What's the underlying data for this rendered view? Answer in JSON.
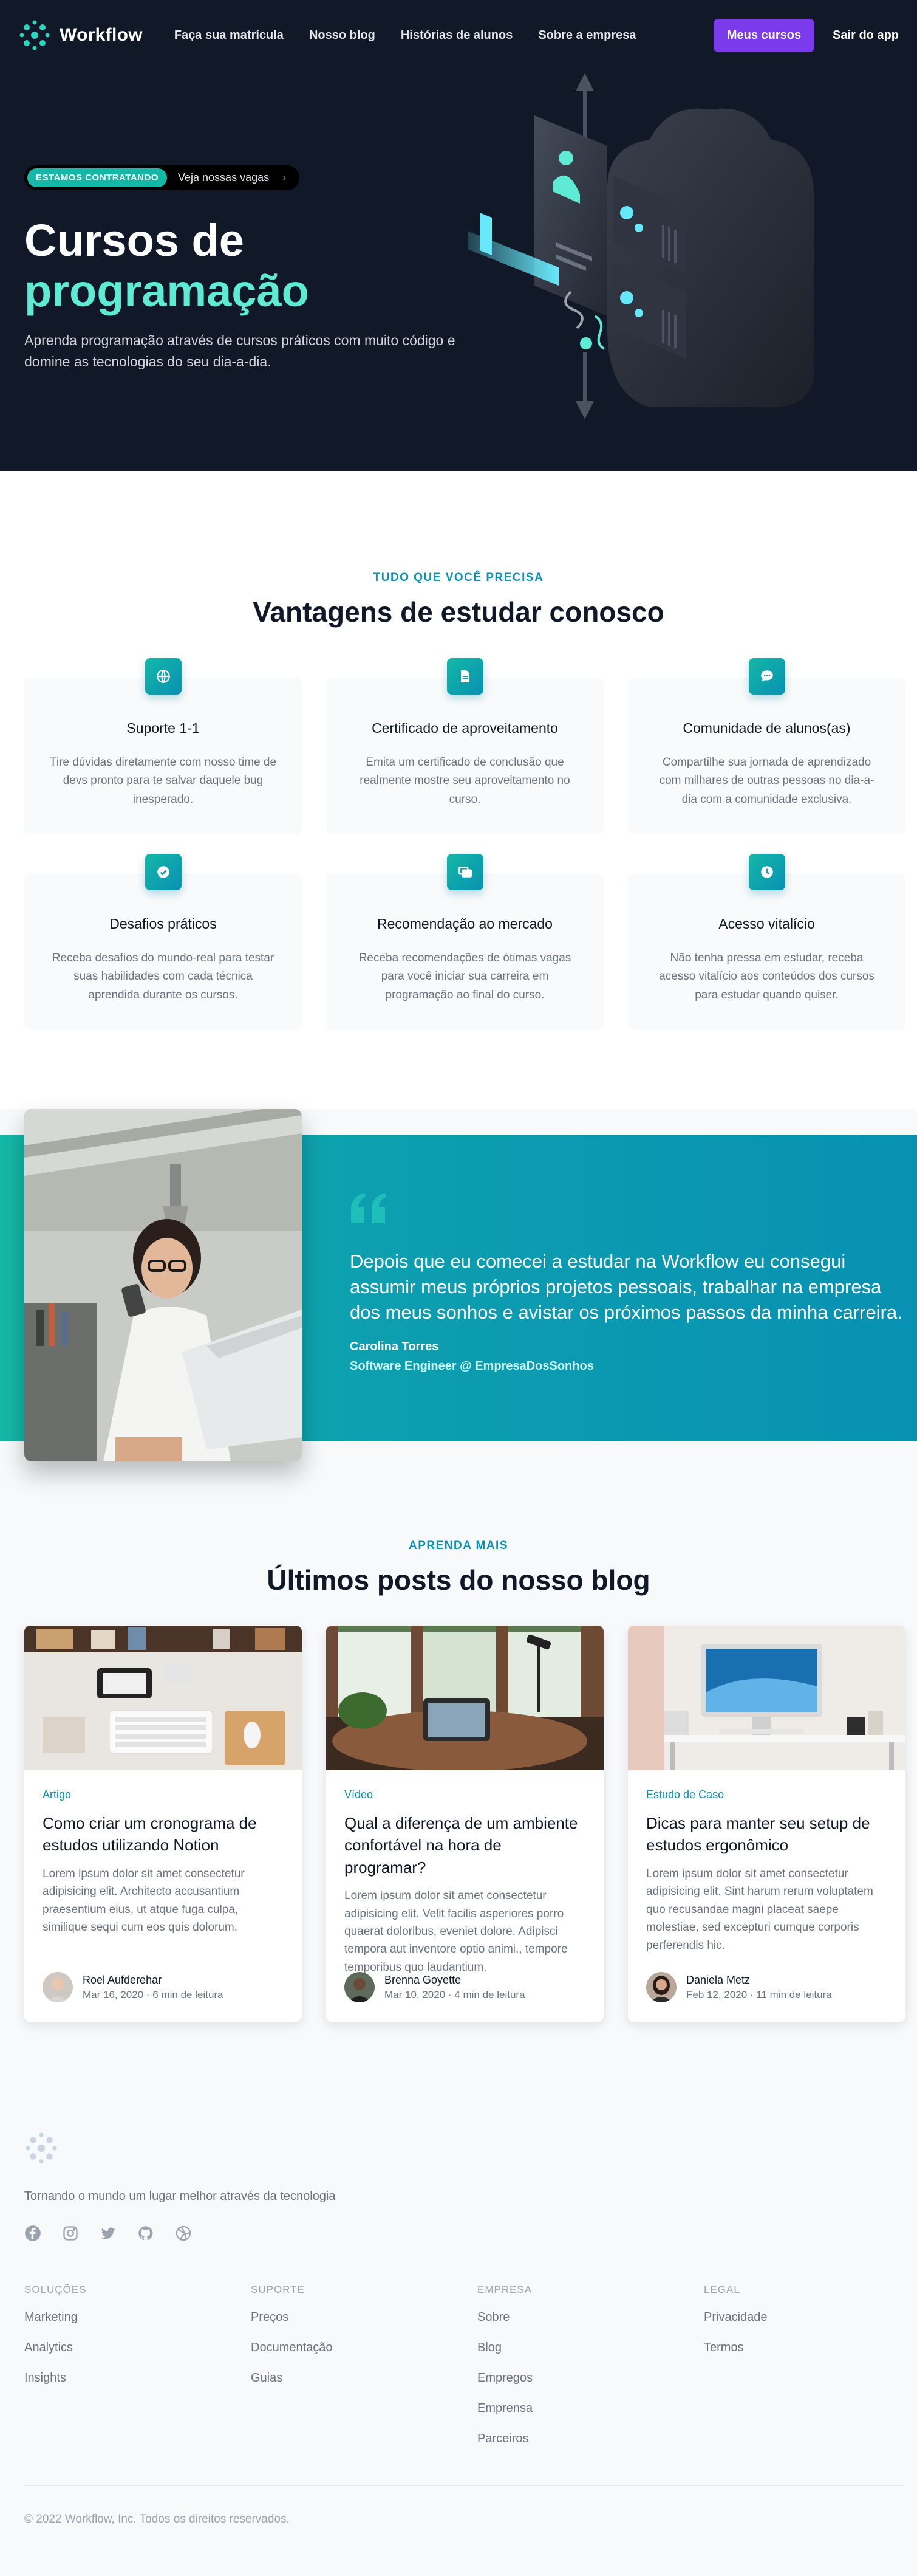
{
  "header": {
    "logo_text": "Workflow",
    "nav": [
      {
        "label": "Faça sua matrícula"
      },
      {
        "label": "Nosso blog"
      },
      {
        "label": "Histórias de alunos"
      },
      {
        "label": "Sobre a empresa"
      }
    ],
    "primary_button": "Meus cursos",
    "exit_link": "Sair do app"
  },
  "hero": {
    "badge": "ESTAMOS CONTRATANDO",
    "badge_link": "Veja nossas vagas",
    "title_line1": "Cursos de",
    "title_line2": "programação",
    "subtitle": "Aprenda programação através de cursos práticos com muito código e domine as tecnologias do seu dia-a-dia."
  },
  "features": {
    "eyebrow": "TUDO QUE VOCÊ PRECISA",
    "title": "Vantagens de estudar conosco",
    "items": [
      {
        "icon": "globe-icon",
        "title": "Suporte 1-1",
        "desc": "Tire dúvidas diretamente com nosso time de devs pronto para te salvar daquele bug inesperado."
      },
      {
        "icon": "document-icon",
        "title": "Certificado de aproveitamento",
        "desc": "Emita um certificado de conclusão que realmente mostre seu aproveitamento no curso."
      },
      {
        "icon": "chat-icon",
        "title": "Comunidade de alunos(as)",
        "desc": "Compartilhe sua jornada de aprendizado com milhares de outras pessoas no dia-a-dia com a comunidade exclusiva."
      },
      {
        "icon": "check-badge-icon",
        "title": "Desafios práticos",
        "desc": "Receba desafios do mundo-real para testar suas habilidades com cada técnica aprendida durante os cursos."
      },
      {
        "icon": "collection-icon",
        "title": "Recomendação ao mercado",
        "desc": "Receba recomendações de ótimas vagas para você iniciar sua carreira em programação ao final do curso."
      },
      {
        "icon": "clock-icon",
        "title": "Acesso vitalício",
        "desc": "Não tenha pressa em estudar, receba acesso vitalício aos conteúdos dos cursos para estudar quando quiser."
      }
    ]
  },
  "testimonial": {
    "quote": "Depois que eu comecei a estudar na Workflow eu consegui assumir meus próprios projetos pessoais, trabalhar na empresa dos meus sonhos e avistar os próximos passos da minha carreira.",
    "name": "Carolina Torres",
    "role": "Software Engineer @ EmpresaDosSonhos"
  },
  "blog": {
    "eyebrow": "APRENDA MAIS",
    "title": "Últimos posts do nosso blog",
    "posts": [
      {
        "category": "Artigo",
        "title": "Como criar um cronograma de estudos utilizando Notion",
        "excerpt": "Lorem ipsum dolor sit amet consectetur adipisicing elit. Architecto accusantium praesentium eius, ut atque fuga culpa, similique sequi cum eos quis dolorum.",
        "author": "Roel Aufderehar",
        "meta": "Mar 16, 2020 · 6 min de leitura"
      },
      {
        "category": "Vídeo",
        "title": "Qual a diferença de um ambiente confortável na hora de programar?",
        "excerpt": "Lorem ipsum dolor sit amet consectetur adipisicing elit. Velit facilis asperiores porro quaerat doloribus, eveniet dolore. Adipisci tempora aut inventore optio animi., tempore temporibus quo laudantium.",
        "author": "Brenna Goyette",
        "meta": "Mar 10, 2020 · 4 min de leitura"
      },
      {
        "category": "Estudo de Caso",
        "title": "Dicas para manter seu setup de estudos ergonômico",
        "excerpt": "Lorem ipsum dolor sit amet consectetur adipisicing elit. Sint harum rerum voluptatem quo recusandae magni placeat saepe molestiae, sed excepturi cumque corporis perferendis hic.",
        "author": "Daniela Metz",
        "meta": "Feb 12, 2020 · 11 min de leitura"
      }
    ]
  },
  "footer": {
    "tagline": "Tornando o mundo um lugar melhor através da tecnologia",
    "socials": [
      "facebook-icon",
      "instagram-icon",
      "twitter-icon",
      "github-icon",
      "dribbble-icon"
    ],
    "columns": [
      {
        "heading": "SOLUÇÕES",
        "links": [
          "Marketing",
          "Analytics",
          "Insights"
        ]
      },
      {
        "heading": "SUPORTE",
        "links": [
          "Preços",
          "Documentação",
          "Guias"
        ]
      },
      {
        "heading": "EMPRESA",
        "links": [
          "Sobre",
          "Blog",
          "Empregos",
          "Emprensa",
          "Parceiros"
        ]
      },
      {
        "heading": "LEGAL",
        "links": [
          "Privacidade",
          "Termos"
        ]
      }
    ],
    "copyright": "© 2022 Workflow, Inc. Todos os direitos reservados."
  },
  "colors": {
    "hero_bg": "#111827",
    "accent_teal": "#14b8a6",
    "accent_cyan": "#0891b2",
    "primary_purple": "#7c3aed"
  }
}
